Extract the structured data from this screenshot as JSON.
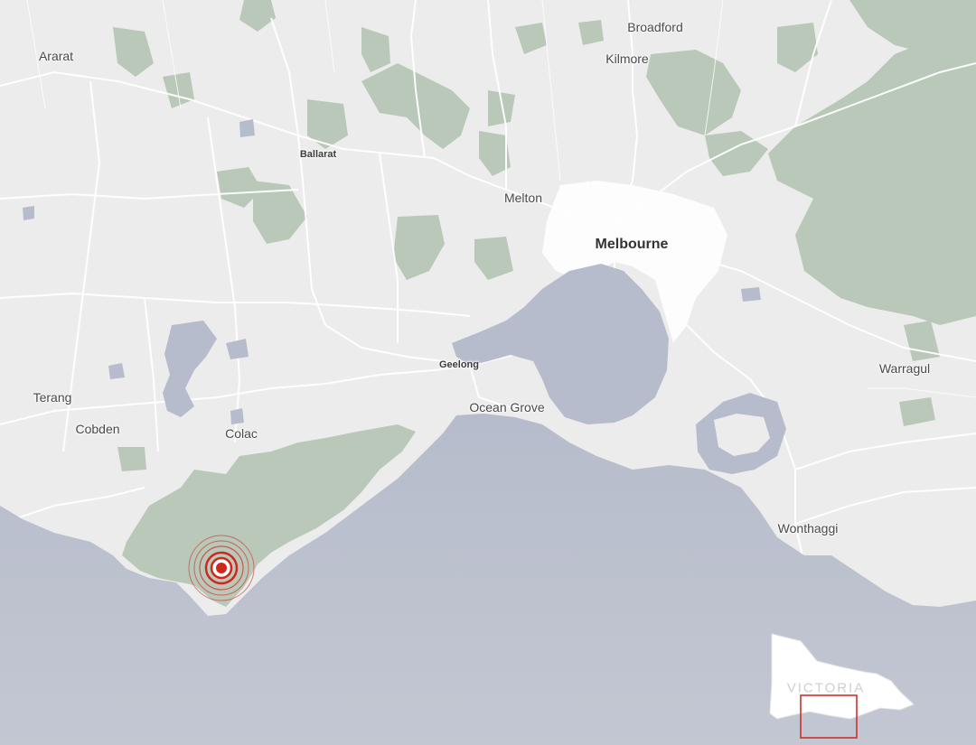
{
  "map": {
    "colors": {
      "land": "#ececec",
      "water": "#b6bccb",
      "park": "#b9c8b8",
      "road": "#ffffff",
      "marker": "#d0271d",
      "inset_frame": "#c8332c"
    },
    "place_labels": [
      {
        "id": "ararat",
        "text": "Ararat",
        "class": "town"
      },
      {
        "id": "broadford",
        "text": "Broadford",
        "class": "town"
      },
      {
        "id": "kilmore",
        "text": "Kilmore",
        "class": "town"
      },
      {
        "id": "ballarat",
        "text": "Ballarat",
        "class": "small"
      },
      {
        "id": "melton",
        "text": "Melton",
        "class": "town"
      },
      {
        "id": "melbourne",
        "text": "Melbourne",
        "class": "city"
      },
      {
        "id": "geelong",
        "text": "Geelong",
        "class": "small"
      },
      {
        "id": "warragul",
        "text": "Warragul",
        "class": "town"
      },
      {
        "id": "terang",
        "text": "Terang",
        "class": "town"
      },
      {
        "id": "cobden",
        "text": "Cobden",
        "class": "town"
      },
      {
        "id": "colac",
        "text": "Colac",
        "class": "town"
      },
      {
        "id": "ocean-grove",
        "text": "Ocean Grove",
        "class": "town"
      },
      {
        "id": "wonthaggi",
        "text": "Wonthaggi",
        "class": "town"
      }
    ],
    "marker": {
      "name": "epicentre-marker",
      "icon": "concentric-circles"
    },
    "inset": {
      "region_label": "VICTORIA"
    }
  }
}
